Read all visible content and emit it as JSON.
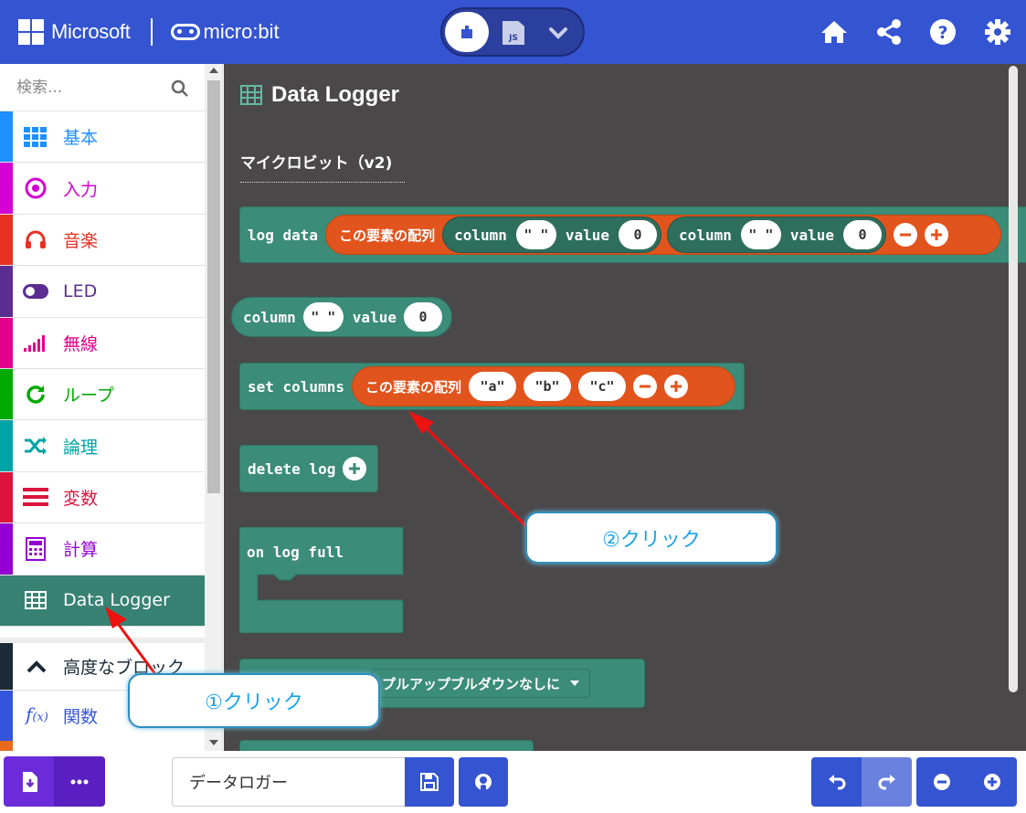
{
  "header": {
    "ms_brand": "Microsoft",
    "product": "micro:bit",
    "editor_toggle": {
      "blocks": "blocks-icon",
      "js_label": "JS",
      "more": "chevron-down-icon"
    },
    "icons": [
      "home-icon",
      "share-icon",
      "help-icon",
      "gear-icon"
    ],
    "colors": {
      "bar": "#3454d1"
    }
  },
  "sidebar": {
    "search": {
      "placeholder": "検索..."
    },
    "categories": [
      {
        "label": "基本",
        "color": "#1e90ff",
        "icon": "grid-icon"
      },
      {
        "label": "入力",
        "color": "#d400d4",
        "icon": "target-icon"
      },
      {
        "label": "音楽",
        "color": "#e63022",
        "icon": "headphones-icon"
      },
      {
        "label": "LED",
        "color": "#5c2d91",
        "icon": "toggle-icon"
      },
      {
        "label": "無線",
        "color": "#e3008c",
        "icon": "signal-icon"
      },
      {
        "label": "ループ",
        "color": "#00aa00",
        "icon": "refresh-icon"
      },
      {
        "label": "論理",
        "color": "#00a4a6",
        "icon": "shuffle-icon"
      },
      {
        "label": "変数",
        "color": "#dc143c",
        "icon": "lines-icon"
      },
      {
        "label": "計算",
        "color": "#9400d3",
        "icon": "calculator-icon"
      },
      {
        "label": "Data Logger",
        "color": "#378273",
        "icon": "table-icon",
        "active": true
      }
    ],
    "advanced": "高度なブロック",
    "functions": "関数"
  },
  "flyout": {
    "title": "Data Logger",
    "subtitle": "マイクロビット（v2)",
    "blocks": {
      "log_data": "log data",
      "array_label": "この要素の配列",
      "column": "column",
      "value": "value",
      "empty_str": "\" \"",
      "zero": "0",
      "set_columns": "set columns",
      "col_a": "\"a\"",
      "col_b": "\"b\"",
      "col_c": "\"c\"",
      "delete_log": "delete log",
      "on_log_full": "on log full",
      "pullup": "プルアップブルダウンなしに"
    }
  },
  "callouts": {
    "first": "①クリック",
    "second": "②クリック"
  },
  "bottom": {
    "project_name": "データロガー",
    "icons": [
      "download-icon",
      "more-icon",
      "save-icon",
      "github-icon",
      "undo-icon",
      "redo-icon",
      "zoom-out-icon",
      "zoom-in-icon"
    ]
  }
}
